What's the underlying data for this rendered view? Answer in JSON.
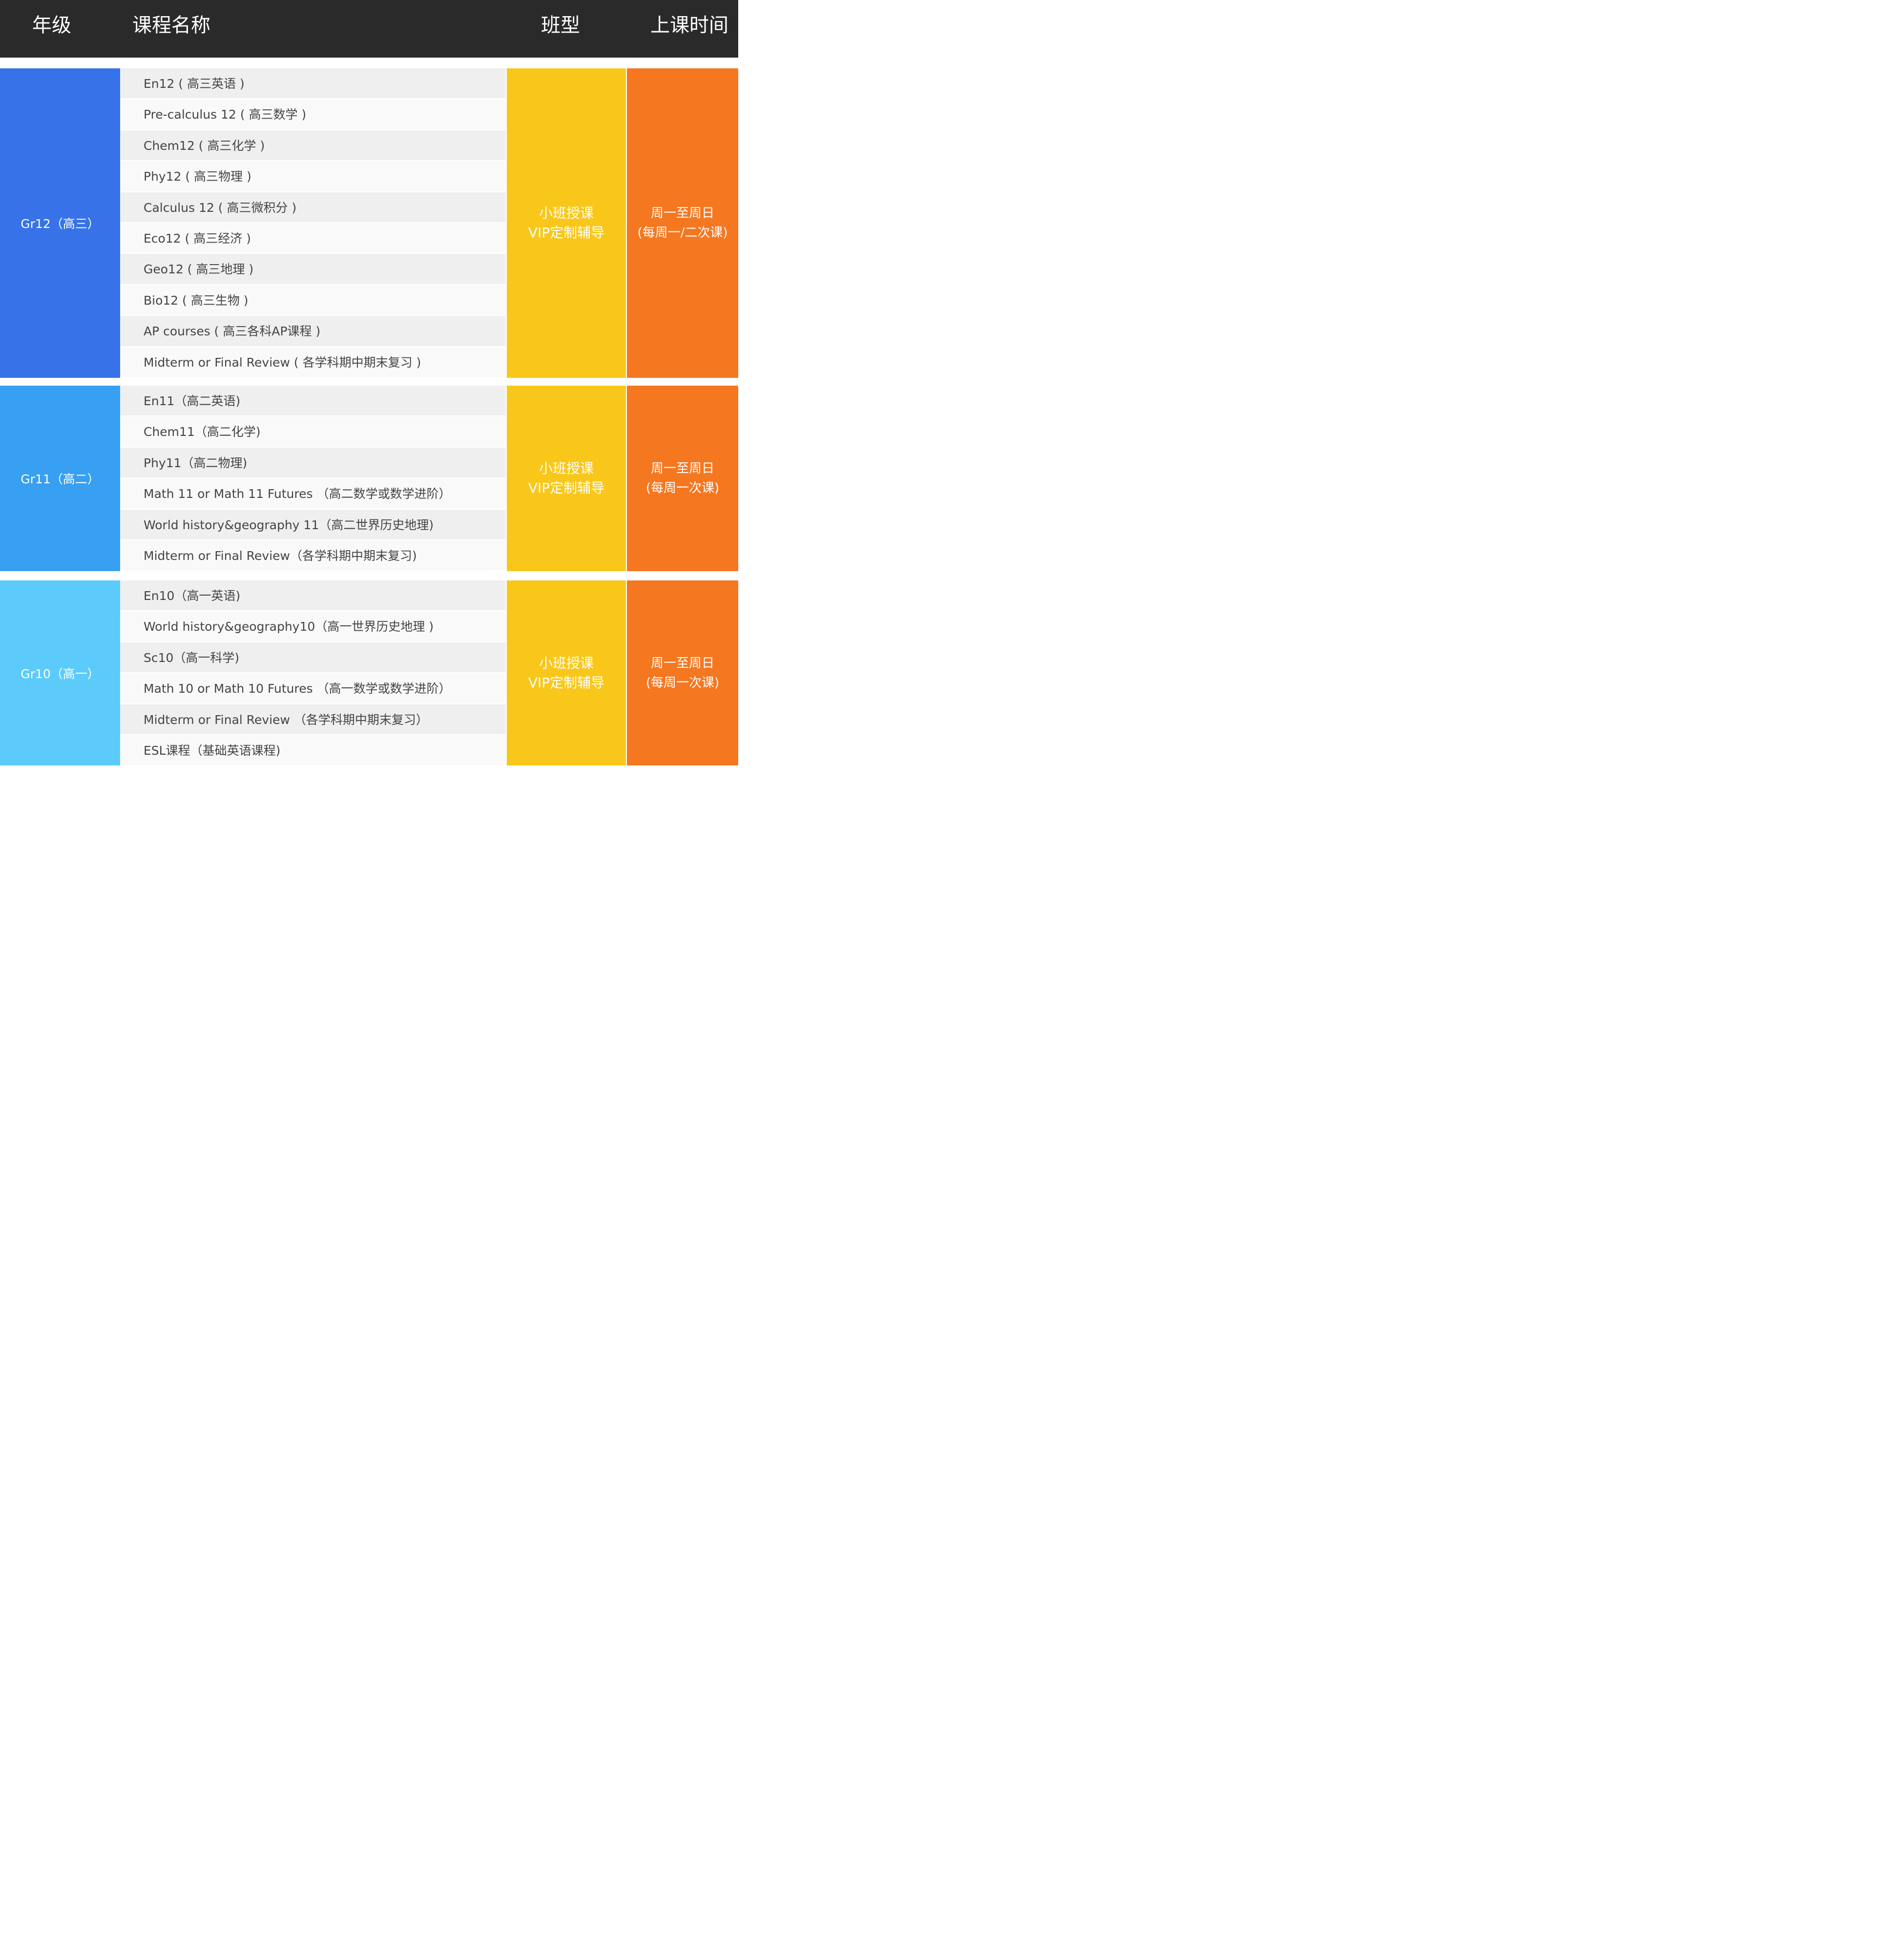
{
  "header": {
    "grade": "年级",
    "course_name": "课程名称",
    "class_type": "班型",
    "class_time": "上课时间"
  },
  "colors": {
    "header_bg": "#2a2a2a",
    "gr12": "#3772e9",
    "gr11": "#37a0f2",
    "gr10": "#5ccbfc",
    "class_type_bg": "#f8c71a",
    "class_time_bg": "#f57720"
  },
  "sections": [
    {
      "grade": "Gr12（高三）",
      "courses": [
        "En12 ( 高三英语 )",
        "Pre-calculus 12 ( 高三数学 )",
        "Chem12 ( 高三化学 )",
        "Phy12 ( 高三物理 )",
        "Calculus 12 ( 高三微积分 )",
        "Eco12 ( 高三经济 )",
        "Geo12 ( 高三地理 )",
        "Bio12 ( 高三生物 )",
        "AP courses ( 高三各科AP课程 )",
        "Midterm or Final Review ( 各学科期中期末复习 )"
      ],
      "class_type": [
        "小班授课",
        "VIP定制辅导"
      ],
      "class_time": [
        "周一至周日",
        "(每周一/二次课)"
      ]
    },
    {
      "grade": "Gr11（高二）",
      "courses": [
        "En11（高二英语)",
        "Chem11（高二化学)",
        "Phy11（高二物理)",
        "Math 11 or Math 11 Futures （高二数学或数学进阶）",
        "World history&geography 11（高二世界历史地理)",
        "Midterm or Final Review（各学科期中期末复习)"
      ],
      "class_type": [
        "小班授课",
        "VIP定制辅导"
      ],
      "class_time": [
        "周一至周日",
        "(每周一次课)"
      ]
    },
    {
      "grade": "Gr10（高一）",
      "courses": [
        "En10（高一英语)",
        "World history&geography10（高一世界历史地理 )",
        "Sc10（高一科学)",
        "Math 10 or Math 10 Futures （高一数学或数学进阶）",
        "Midterm or Final Review （各学科期中期末复习）",
        "ESL课程（基础英语课程)"
      ],
      "class_type": [
        "小班授课",
        "VIP定制辅导"
      ],
      "class_time": [
        "周一至周日",
        "(每周一次课)"
      ]
    }
  ]
}
